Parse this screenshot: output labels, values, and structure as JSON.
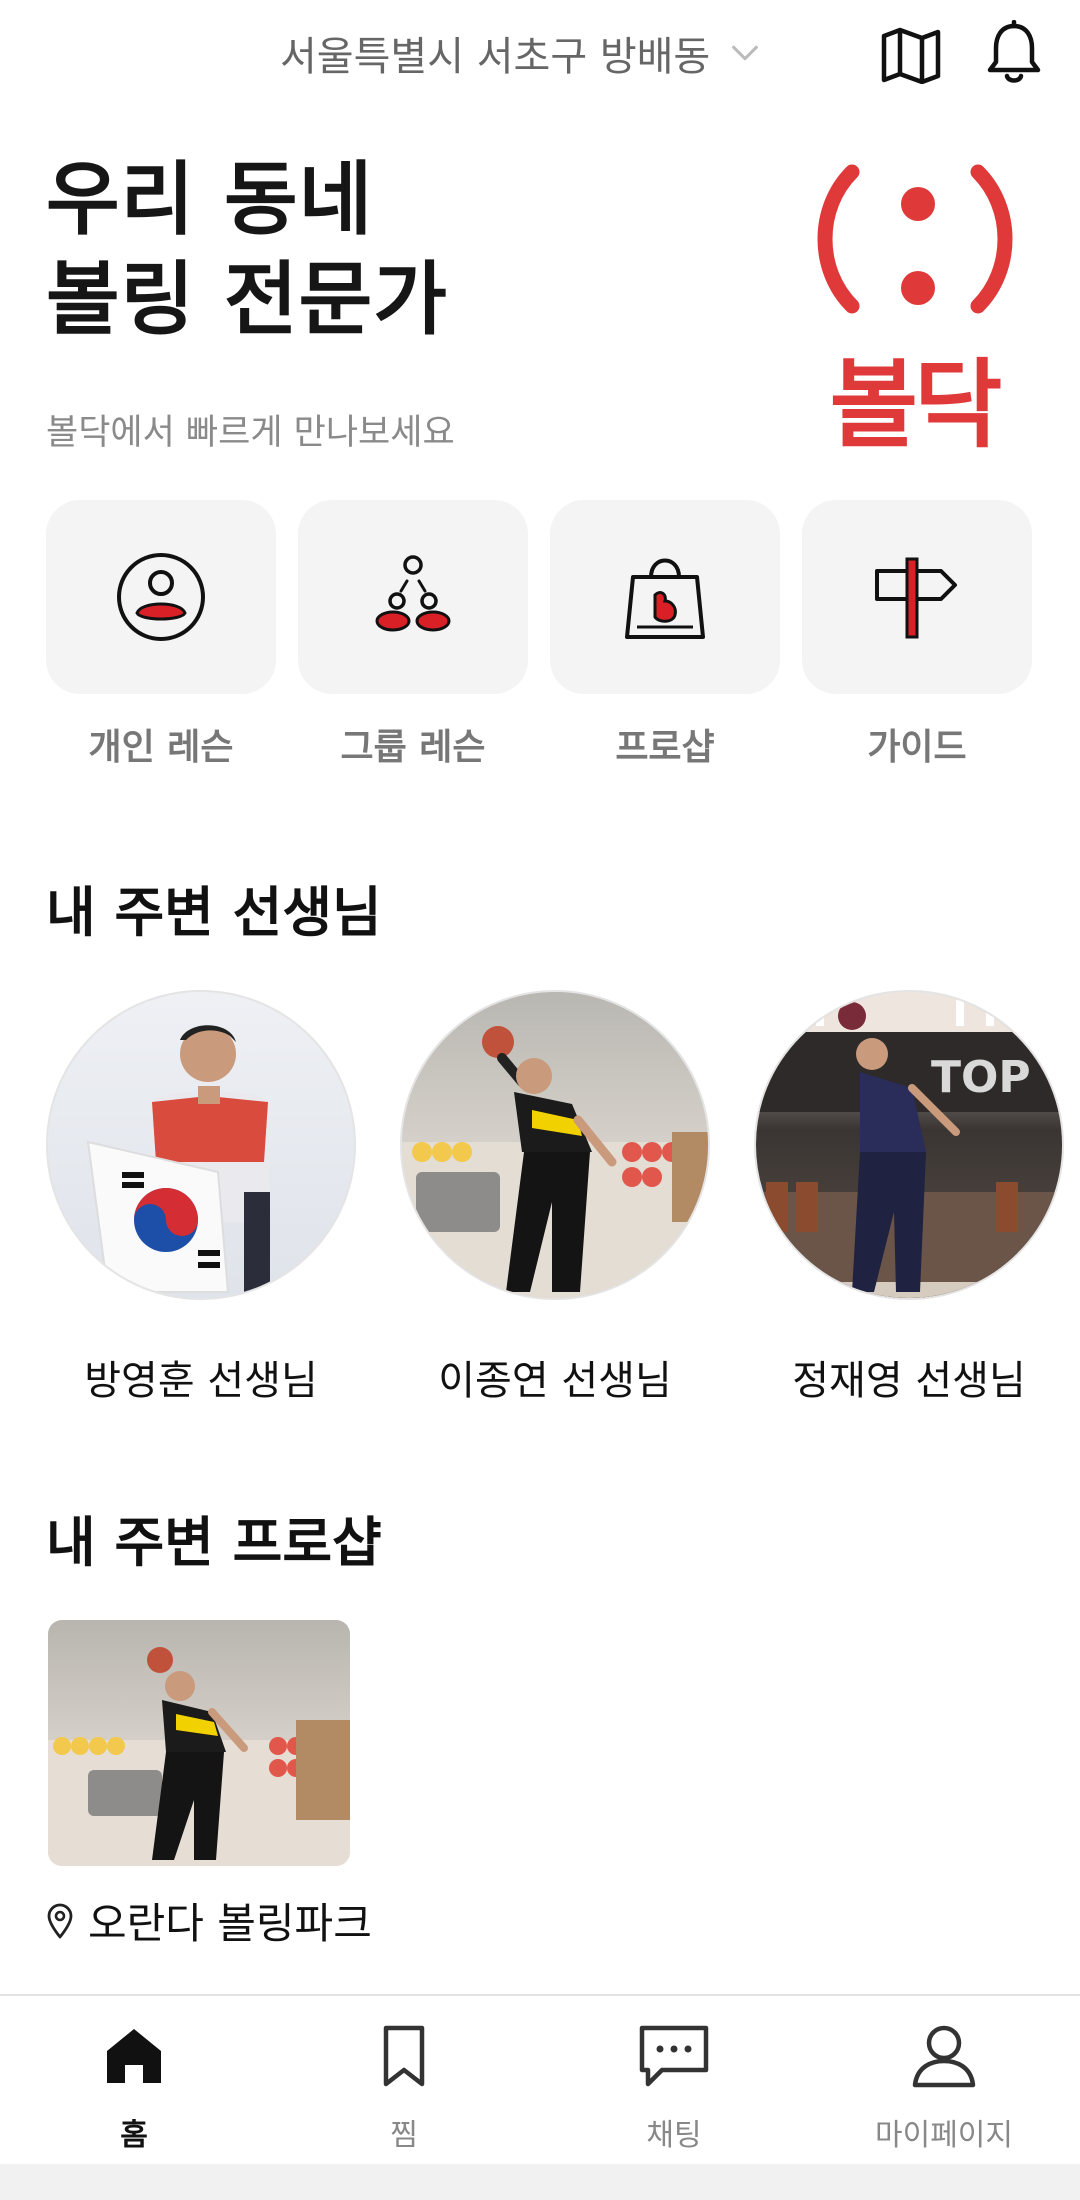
{
  "header": {
    "location": "서울특별시 서초구 방배동",
    "icons": [
      "chevron-down-icon",
      "map-icon",
      "bell-icon"
    ]
  },
  "hero": {
    "title_line1": "우리 동네",
    "title_line2": "볼링 전문가",
    "subtitle": "볼닥에서 빠르게 만나보세요",
    "logo_text": "볼닥",
    "brand_color": "#e0393a"
  },
  "categories": [
    {
      "label": "개인 레슨",
      "icon": "person-icon"
    },
    {
      "label": "그룹 레슨",
      "icon": "group-icon"
    },
    {
      "label": "프로샵",
      "icon": "shopping-bag-icon"
    },
    {
      "label": "가이드",
      "icon": "signpost-icon"
    }
  ],
  "teachers_section": {
    "title": "내 주변 선생님",
    "items": [
      {
        "name": "방영훈 선생님"
      },
      {
        "name": "이종연 선생님"
      },
      {
        "name": "정재영 선생님"
      }
    ]
  },
  "proshop_section": {
    "title": "내 주변 프로샵",
    "items": [
      {
        "name": "오란다 볼링파크",
        "icon": "location-pin-icon"
      }
    ]
  },
  "bottom_nav": [
    {
      "label": "홈",
      "icon": "home-icon",
      "active": true
    },
    {
      "label": "찜",
      "icon": "bookmark-icon",
      "active": false
    },
    {
      "label": "채팅",
      "icon": "chat-icon",
      "active": false
    },
    {
      "label": "마이페이지",
      "icon": "user-icon",
      "active": false
    }
  ]
}
